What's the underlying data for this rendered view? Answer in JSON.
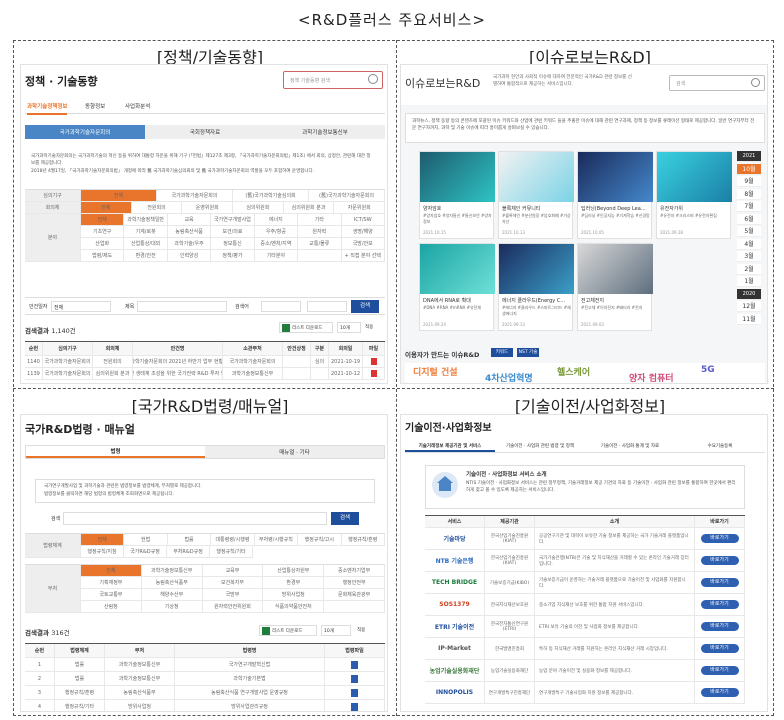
{
  "page_title": "<R&D플러스 주요서비스>",
  "panels": {
    "p1": {
      "heading": "[정책/기술동향]",
      "site_title": "정책 · 기술동향",
      "search_placeholder": "정책 기술동향 검색",
      "tabs": [
        "과학기술정책정보",
        "동향정보",
        "사업화분석"
      ],
      "subtabs": [
        "국가과학기술자문회의",
        "국회정책자료",
        "과학기술정보통신부"
      ],
      "notice1": "국가과학기술자문회의는 국가과학기술의 혁신 등을 위하여 대통령 자문을 위해 기구 (「헌법」제127조 제3항, 「국가과학기술자문회의법」제1조) 에서 회의, 상정안, 관련해 대한 정보를 제공합니다.",
      "notice2": "2018년 4월17일, 「국가과학기술자문회의법」 개정에 따라 舊 국가과학기술심의회의 및 舊 국가과학기술자문회의 역할을 모두 포함하여 운영합니다.",
      "filter_labels": [
        "심의기구",
        "회의체",
        "분야"
      ],
      "filter_all": "전체",
      "filter_row1": [
        "전체",
        "국가과학기술자문회의",
        "(舊)국가과학기술심의회",
        "(舊)국가과학기술자문회의"
      ],
      "filter_row2": [
        "전체",
        "전원회의",
        "운영위원회",
        "심의위원회",
        "심의위원회 분과",
        "자문위원회"
      ],
      "filter_row3": [
        [
          "전체",
          "과학기술정책일반",
          "교육",
          "국가연구개발사업",
          "에너지",
          "기타",
          "ICT/SW"
        ],
        [
          "기초연구",
          "기계/로봇",
          "농림축산식품",
          "보건/의료",
          "우주/항공",
          "원자력",
          "생명/해양"
        ],
        [
          "산업화",
          "산업통상/대외",
          "과학기술/우주",
          "정보통신",
          "중소/벤처/지역",
          "교통/물류",
          "국방/안보"
        ],
        [
          "법령/제도",
          "환경/안전",
          "인력양성",
          "정책/평가",
          "기타분야",
          "",
          "+ 직접 분야 선택"
        ]
      ],
      "date_label": "안건일자",
      "date_select": "전체",
      "date_from": "",
      "date_to": "",
      "kw_label": "제목",
      "kw2_label": "검색어",
      "search_btn": "검색",
      "result_label": "검색결과",
      "result_count": "1,140건",
      "excel_btn": "리스트 다운로드",
      "per_page": "10개",
      "per_page_btn": "적용",
      "table_headers": [
        "순번",
        "심의기구",
        "회의체",
        "안건명",
        "소관부처",
        "안건상정",
        "구분",
        "회의일",
        "파일"
      ],
      "table_rows": [
        [
          "1140",
          "국가과학기술자문회의",
          "전원회의",
          "국가과학기술자문회의 2021년 하반기 업무 현황 보고",
          "국가과학기술자문회의",
          "",
          "심의",
          "2021-10-19",
          ""
        ],
        [
          "1139",
          "국가과학기술자문회의",
          "심의위원회 분과",
          "혁신 생태계 조성을 위한 국가전략 R&D 투자 방향",
          "과학기술정보통신부",
          "",
          "",
          "2021-10-12",
          ""
        ]
      ]
    },
    "p2": {
      "heading": "[이슈로보는R&D]",
      "site_title": "이슈로보는R&D",
      "site_desc": "국가과학 현안과 사회적 이슈에 대하여 전문적인 국가R&D 관련 정보를 선별하여 통합적으로 제공하는 서비스입니다.",
      "search_placeholder": "검색",
      "intro": "과학뉴스, 정책 동향 등의 콘텐츠에 포괄된 이슈 키워드와 산업에 관련 키워드 들을 추출한 이슈에 대해 관련 연구과제, 정책 등 정보를 큐레이션 형태로 제공합니다. 일반 연구자부터 전문 연구자까지, 과학 및 기술 이슈에 따라 흥미롭게 살펴보실 수 있습니다.",
      "cards": [
        {
          "title": "양자암호",
          "tags": "#양자암호 #양자통신 #통신보안 #양자정보",
          "date": "2021.10.15"
        },
        {
          "title": "블록체인 커뮤니티",
          "tags": "#블록체인 #분산원장 #암호화폐 #가상자산",
          "date": "2021.10.13"
        },
        {
          "title": "딥러닝(Beyond Deep Lea...",
          "tags": "#딥러닝 #인공지능 #기계학습 #신경망",
          "date": "2021.10.05"
        },
        {
          "title": "유전자가위",
          "tags": "#유전자 #크리스퍼 #유전자편집",
          "date": "2021.09.28"
        },
        {
          "title": "DNA에서 RNA로 확대",
          "tags": "#DNA #RNA #mRNA #유전체",
          "date": "2021.09.24"
        },
        {
          "title": "에너지 클라우드(Energy C...",
          "tags": "#에너지 #클라우드 #스마트그리드 #재생에너지",
          "date": "2021.09.13"
        },
        {
          "title": "전고체전지",
          "tags": "#전고체 #이차전지 #배터리 #전지",
          "date": "2021.09.03"
        }
      ],
      "years": [
        "2021",
        "10월",
        "9월",
        "8월",
        "7월",
        "6월",
        "5월",
        "4월",
        "3월",
        "2월",
        "1월",
        "2020",
        "12월",
        "11월"
      ],
      "bottom_title": "이용자가 만드는 이슈R&D",
      "bottom_btns": [
        "키워드",
        "NST 기술"
      ],
      "bottom_words": [
        "디지털 건설",
        "4차산업혁명",
        "헬스케어",
        "양자 컴퓨터",
        "5G"
      ]
    },
    "p3": {
      "heading": "[국가R&D법령/매뉴얼]",
      "site_title": "국가R&D법령 · 매뉴얼",
      "tabs": [
        "법령",
        "매뉴얼 · 기타"
      ],
      "notice1": "국가연구개발사업 및 과학기술과 관련된 법령정보를 법령체계, 부처별로 제공합니다.",
      "notice2": "법령정보를 클릭하면 해당 법령의 법령체계 조회화면으로 제공됩니다.",
      "kw_label": "검색",
      "search_btn": "검색",
      "filter_labels": [
        "법령체계",
        "부처"
      ],
      "row1": [
        "전체",
        "헌법",
        "법률",
        "대통령령/시행령",
        "부처령/시행규칙",
        "행정규칙/고시",
        "행정규칙/훈령"
      ],
      "row2": [
        "행정규칙/지침",
        "국가R&D규정",
        "부처R&D규정",
        "행정규칙/기타"
      ],
      "row3": [
        [
          "전체",
          "과학기술정보통신부",
          "교육부",
          "산업통상자원부",
          "중소벤처기업부"
        ],
        [
          "기획재정부",
          "농림축산식품부",
          "보건복지부",
          "환경부",
          "행정안전부"
        ],
        [
          "국토교통부",
          "해양수산부",
          "국방부",
          "방위사업청",
          "문화체육관광부"
        ],
        [
          "산림청",
          "기상청",
          "원자력안전위원회",
          "식품의약품안전처",
          ""
        ]
      ],
      "result_label": "검색결과",
      "result_count": "316건",
      "excel_btn": "리스트 다운로드",
      "per_page": "10개",
      "per_page_btn": "적용",
      "headers": [
        "순번",
        "법령체계",
        "부처",
        "법령명",
        "법령파일"
      ],
      "rows": [
        [
          "1",
          "법률",
          "과학기술정보통신부",
          "국가연구개발혁신법",
          ""
        ],
        [
          "2",
          "법률",
          "과학기술정보통신부",
          "과학기술기본법",
          ""
        ],
        [
          "3",
          "행정규칙/훈령",
          "농림축산식품부",
          "농림축산식품 연구개발사업 운영규정",
          ""
        ],
        [
          "4",
          "행정규칙/기타",
          "방위사업청",
          "방위사업관리규정",
          ""
        ]
      ]
    },
    "p4": {
      "heading": "[기술이전/사업화정보]",
      "site_title": "기술이전·사업화정보",
      "tabs": [
        "기술거래정보 제공기관 및 서비스",
        "기술이전 · 사업화 관련 법령 및 정책",
        "기술이전 · 사업화 통계 및 자료",
        "수요기술등록"
      ],
      "intro_title": "기술이전 · 사업화정보 서비스 소개",
      "intro_text": "NTIS 기술이전 · 사업화정보 서비스는 관련 정부정책, 기술거래정보 제공 기관의 자료 등 기술이전 · 사업화 관련 정보를 통합하여 한곳에서 편리하게 찾고 볼 수 있도록 제공하는 서비스입니다.",
      "headers": [
        "서비스",
        "제공기관",
        "소개",
        "바로가기"
      ],
      "rows": [
        {
          "logo": "기술마당",
          "org": "한국산업기술진흥원(KIAT)",
          "desc": "공공연구기관 및 대학이 보유한 기술 정보를 제공하는 국가 기술거래 플랫폼입니다."
        },
        {
          "logo": "NTB 기술은행",
          "org": "한국산업기술진흥원(KIAT)",
          "desc": "국가기술은행(NTB)은 기술 및 지식재산을 거래할 수 있는 온라인 기술거래 장터입니다."
        },
        {
          "logo": "TECH BRIDGE",
          "org": "기술보증기금(KIBO)",
          "desc": "기술보증기금이 운영하는 기술거래 플랫폼으로 기술이전 및 사업화를 지원합니다."
        },
        {
          "logo": "SOS1379",
          "org": "한국지식재산보호원",
          "desc": "중소기업 지식재산 보호를 위한 통합 지원 서비스입니다."
        },
        {
          "logo": "ETRI 기술이전",
          "org": "한국전자통신연구원(ETRI)",
          "desc": "ETRI 보유 기술의 이전 및 사업화 정보를 제공합니다."
        },
        {
          "logo": "IP-Market",
          "org": "한국발명진흥회",
          "desc": "특허 등 지식재산 거래를 지원하는 온라인 지식재산 거래 시장입니다."
        },
        {
          "logo": "농업기술실용화재단",
          "org": "농업기술실용화재단",
          "desc": "농업 분야 기술이전 및 실용화 정보를 제공합니다."
        },
        {
          "logo": "INNOPOLIS",
          "org": "연구개발특구진흥재단",
          "desc": "연구개발특구 기술사업화 지원 정보를 제공합니다."
        }
      ],
      "go_btn": "바로가기"
    }
  },
  "colors": {
    "accent_orange": "#e9742b",
    "accent_blue": "#4a86c5",
    "navy": "#1f4e9c"
  }
}
